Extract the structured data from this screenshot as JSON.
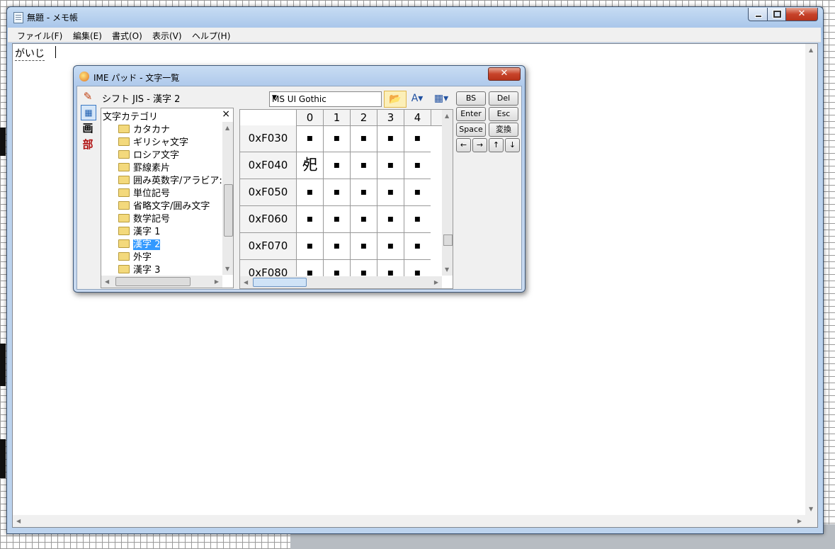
{
  "window": {
    "title": "無題 - メモ帳",
    "close_glyph": "✕"
  },
  "menu": [
    "ファイル(F)",
    "編集(E)",
    "書式(O)",
    "表示(V)",
    "ヘルプ(H)"
  ],
  "editor": {
    "text": "がいじ"
  },
  "ime_pad": {
    "title": "IME パッド - 文字一覧",
    "close_glyph": "✕",
    "category_label": "シフト JIS - 漢字 2",
    "category_header": "文字カテゴリ",
    "category_close": "×",
    "tools": [
      "画",
      "部"
    ],
    "categories": [
      {
        "label": "カタカナ"
      },
      {
        "label": "ギリシャ文字"
      },
      {
        "label": "ロシア文字"
      },
      {
        "label": "罫線素片"
      },
      {
        "label": "囲み英数字/アラビア:"
      },
      {
        "label": "単位記号"
      },
      {
        "label": "省略文字/囲み文字"
      },
      {
        "label": "数学記号"
      },
      {
        "label": "漢字 1"
      },
      {
        "label": "漢字 2"
      },
      {
        "label": "外字"
      },
      {
        "label": "漢字 3"
      }
    ],
    "selected_category": "漢字 2",
    "font": "MS UI Gothic",
    "columns": [
      "0",
      "1",
      "2",
      "3",
      "4"
    ],
    "rows": [
      "0xF030",
      "0xF040",
      "0xF050",
      "0xF060",
      "0xF070",
      "0xF080"
    ],
    "cell_dot": "▪",
    "special_char": "𢀸",
    "keys": {
      "bs": "BS",
      "del": "Del",
      "enter": "Enter",
      "esc": "Esc",
      "space": "Space",
      "convert": "変換",
      "left": "←",
      "right": "→",
      "up": "↑",
      "down": "↓"
    }
  }
}
